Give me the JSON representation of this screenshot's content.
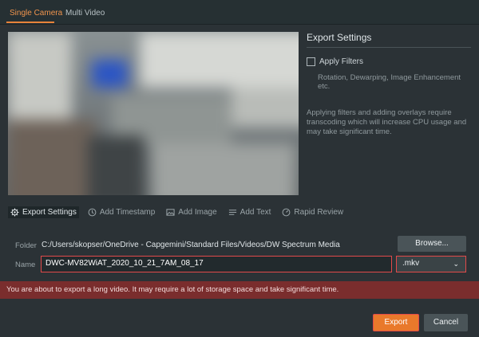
{
  "tabs": [
    {
      "label": "Single Camera",
      "active": true
    },
    {
      "label": "Multi Video",
      "active": false
    }
  ],
  "export_settings": {
    "title": "Export Settings",
    "apply_filters_label": "Apply Filters",
    "apply_filters_checked": false,
    "filters_description": "Rotation, Dewarping, Image Enhancement etc.",
    "transcoding_note": "Applying filters and adding overlays require transcoding which will increase CPU usage and may take significant time."
  },
  "toolbar": {
    "export_settings": "Export Settings",
    "add_timestamp": "Add Timestamp",
    "add_image": "Add Image",
    "add_text": "Add Text",
    "rapid_review": "Rapid Review"
  },
  "form": {
    "folder_label": "Folder",
    "folder_path": "C:/Users/skopser/OneDrive - Capgemini/Standard Files/Videos/DW Spectrum Media",
    "browse_label": "Browse...",
    "name_label": "Name",
    "name_value": "DWC-MV82WiAT_2020_10_21_7AM_08_17",
    "format_value": ".mkv"
  },
  "warning": "You are about to export a long video. It may require a lot of storage space and take significant time.",
  "buttons": {
    "export": "Export",
    "cancel": "Cancel"
  },
  "colors": {
    "accent": "#e9792b",
    "highlight_border": "#e24a4a",
    "warning_bg": "#7a2d2d"
  }
}
